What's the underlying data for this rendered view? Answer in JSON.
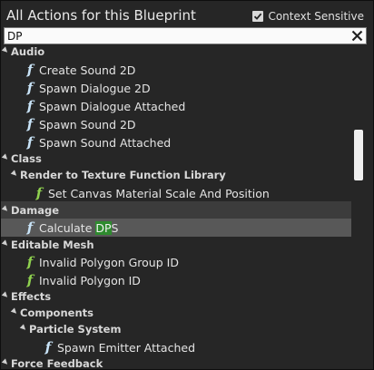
{
  "header": {
    "title": "All Actions for this Blueprint",
    "context_sensitive_label": "Context Sensitive",
    "context_sensitive_checked": true
  },
  "search": {
    "value": "DP"
  },
  "rows": [
    {
      "kind": "category",
      "label": "Audio"
    },
    {
      "kind": "action",
      "label": "Create Sound 2D"
    },
    {
      "kind": "action",
      "label": "Spawn Dialogue 2D"
    },
    {
      "kind": "action",
      "label": "Spawn Dialogue Attached"
    },
    {
      "kind": "action",
      "label": "Spawn Sound 2D"
    },
    {
      "kind": "action",
      "label": "Spawn Sound Attached"
    },
    {
      "kind": "category",
      "label": "Class"
    },
    {
      "kind": "category",
      "label": "Render to Texture Function Library"
    },
    {
      "kind": "action",
      "label": "Set Canvas Material Scale And Position"
    },
    {
      "kind": "category",
      "label": "Damage"
    },
    {
      "kind": "action",
      "label_prefix": "Calculate ",
      "label_match": "DP",
      "label_suffix": "S"
    },
    {
      "kind": "category",
      "label": "Editable Mesh"
    },
    {
      "kind": "action",
      "label": "Invalid Polygon Group ID"
    },
    {
      "kind": "action",
      "label": "Invalid Polygon ID"
    },
    {
      "kind": "category",
      "label": "Effects"
    },
    {
      "kind": "category",
      "label": "Components"
    },
    {
      "kind": "category",
      "label": "Particle System"
    },
    {
      "kind": "action",
      "label": "Spawn Emitter Attached"
    },
    {
      "kind": "category",
      "label": "Force Feedback"
    }
  ],
  "colors": {
    "function_icon_blue": "#c8e3f7",
    "function_icon_green": "#8fd14f",
    "search_match_highlight": "#2e8b2e",
    "selected_row": "#585858",
    "hover_row": "#3c3c3c"
  }
}
